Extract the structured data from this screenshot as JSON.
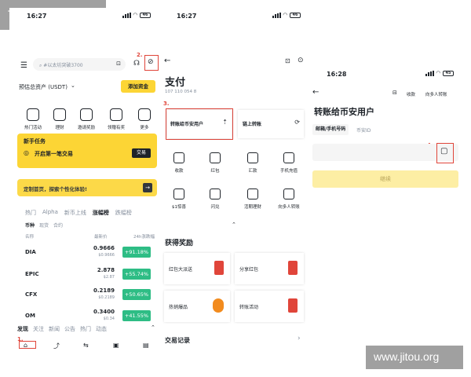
{
  "watermark_tl": "TG: MYYJJPP",
  "watermark_br": "www.jitou.org",
  "colors": {
    "brand": "#fcd535",
    "green": "#2ebd85",
    "annotation": "#e0453a"
  },
  "screen1": {
    "time": "16:27",
    "battery": "46",
    "search_placeholder": "#以太坊突破3700",
    "step2": "2.",
    "total_label": "预估总资产 (USDT)",
    "add_funds": "添加资金",
    "shortcuts": [
      "热门活动",
      "理财",
      "邀请奖励",
      "领赠有奖",
      "更多"
    ],
    "task_title": "新手任务",
    "task_text": "开启第一笔交易",
    "task_button": "交易",
    "custom_banner": "定制首页，探索个性化体验!",
    "market_tabs": [
      "热门",
      "Alpha",
      "新币上线",
      "涨幅榜",
      "跌幅榜"
    ],
    "sub_tabs": [
      "币种",
      "现货",
      "合约"
    ],
    "col_name": "名称",
    "col_price": "最新价",
    "col_change": "24h涨跌幅",
    "rows": [
      {
        "name": "DIA",
        "price": "0.9666",
        "sub": "$0.9666",
        "change": "+91.18%"
      },
      {
        "name": "EPIC",
        "price": "2.878",
        "sub": "$2.87",
        "change": "+55.74%"
      },
      {
        "name": "CFX",
        "price": "0.2189",
        "sub": "$0.2189",
        "change": "+50.65%"
      },
      {
        "name": "OM",
        "price": "0.3400",
        "sub": "$0.34",
        "change": "+41.55%"
      }
    ],
    "feed_tabs": [
      "发现",
      "关注",
      "新闻",
      "公告",
      "热门",
      "动态"
    ],
    "step1": "1."
  },
  "screen2": {
    "time": "16:27",
    "battery": "46",
    "title": "支付",
    "uid": "107 110 054 8",
    "step3": "3.",
    "transfer_binance": "转账给币安用户",
    "transfer_chain": "链上转账",
    "grid": [
      "收款",
      "红包",
      "汇款",
      "手机充值",
      "$1惊喜",
      "闪兑",
      "活期理财",
      "向多人转账"
    ],
    "rewards_title": "获得奖励",
    "rewards": [
      "红包大派送",
      "分享红包",
      "热销爆品",
      "转账活动"
    ],
    "records": "交易记录"
  },
  "screen3": {
    "time": "16:28",
    "battery": "45",
    "receive": "收款",
    "multi": "向多人转账",
    "title": "转账给币安用户",
    "tab_email": "邮箱/手机号码",
    "tab_id": "币安ID",
    "step4": "4.",
    "continue": "继续"
  }
}
